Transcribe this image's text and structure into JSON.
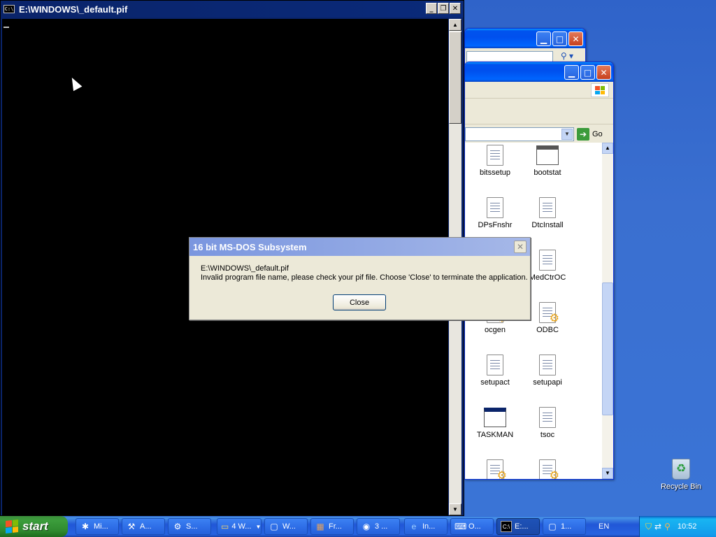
{
  "console": {
    "title": "E:\\WINDOWS\\_default.pif",
    "icon": "C:\\"
  },
  "explorer": {
    "go_label": "Go",
    "icons": [
      "bitssetup",
      "bootstat",
      "DPsFnshr",
      "DtcInstall",
      "MedCtrOC",
      "ocgen",
      "ODBC",
      "setupact",
      "setupapi",
      "TASKMAN",
      "tsoc"
    ]
  },
  "dialog": {
    "title": "16 bit MS-DOS Subsystem",
    "line1": "E:\\WINDOWS\\_default.pif",
    "line2": "Invalid program file name, please check your pif file.  Choose 'Close' to terminate the application.",
    "close_button": "Close"
  },
  "desktop": {
    "recycle_bin": "Recycle Bin"
  },
  "taskbar": {
    "start": "start",
    "items": [
      "Mi...",
      "A...",
      "S...",
      "4 W...",
      "W...",
      "Fr...",
      "3 ...",
      "In...",
      "O...",
      "E:...",
      "1..."
    ],
    "language": "EN",
    "clock": "10:52"
  }
}
